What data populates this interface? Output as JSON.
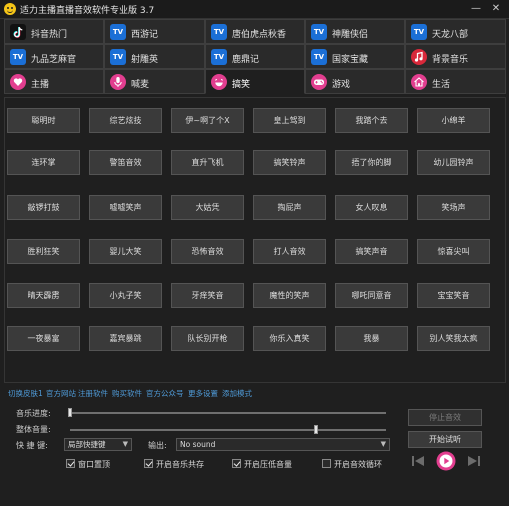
{
  "window": {
    "title": "适力主播直播音效软件专业版 3.7",
    "minimize": "—",
    "close": "✕"
  },
  "tabs": [
    {
      "label": "抖音热门",
      "icon": "tiktok-icon",
      "active": false
    },
    {
      "label": "西游记",
      "icon": "tv-icon",
      "active": false
    },
    {
      "label": "唐伯虎点秋香",
      "icon": "tv-icon",
      "active": false
    },
    {
      "label": "神雕侠侣",
      "icon": "tv-icon",
      "active": false
    },
    {
      "label": "天龙八部",
      "icon": "tv-icon",
      "active": false
    },
    {
      "label": "九品芝麻官",
      "icon": "tv-icon",
      "active": false
    },
    {
      "label": "射雕英",
      "icon": "tv-icon",
      "active": false
    },
    {
      "label": "鹿鼎记",
      "icon": "tv-icon",
      "active": false
    },
    {
      "label": "国家宝藏",
      "icon": "tv-icon",
      "active": false
    },
    {
      "label": "背景音乐",
      "icon": "music-note-icon",
      "active": false
    },
    {
      "label": "主播",
      "icon": "heart-icon",
      "active": false
    },
    {
      "label": "喊麦",
      "icon": "microphone-icon",
      "active": false
    },
    {
      "label": "搞笑",
      "icon": "laughing-face-icon",
      "active": true
    },
    {
      "label": "游戏",
      "icon": "gamepad-icon",
      "active": false
    },
    {
      "label": "生活",
      "icon": "home-icon",
      "active": false
    }
  ],
  "sound_effects": [
    [
      "聪明时",
      "综艺炫技",
      "伊~啊了个X",
      "皇上驾到",
      "我踏个去",
      "小绵羊"
    ],
    [
      "连环掌",
      "警笛音效",
      "直升飞机",
      "搞笑铃声",
      "捂了你的脚",
      "幼儿园铃声"
    ],
    [
      "敲锣打鼓",
      "嘘嘘笑声",
      "大姑凭",
      "掏屁声",
      "女人叹息",
      "笑场声"
    ],
    [
      "胜利狂笑",
      "婴儿大笑",
      "恐怖音效",
      "打人音效",
      "搞笑声音",
      "惊喜尖叫"
    ],
    [
      "晴天霹雳",
      "小丸子笑",
      "牙痒笑音",
      "魔性的笑声",
      "哪吒同意音",
      "宝宝笑音"
    ],
    [
      "一夜暴富",
      "嘉宾暴跳",
      "队长别开枪",
      "你乐入真笑",
      "我暴",
      "别人笑我太疯"
    ]
  ],
  "links": [
    "切换皮肤1",
    "官方网站",
    "注册软件",
    "购买软件",
    "官方公众号",
    "更多设置",
    "添加模式"
  ],
  "controls": {
    "music_progress_label": "音乐进度:",
    "volume_label": "整体音量:",
    "hotkey_label": "快 捷 键:",
    "hotkey_value": "局部快捷键",
    "output_label": "输出:",
    "output_value": "No sound",
    "music_progress": 0.0,
    "volume": 0.78
  },
  "checkboxes": [
    {
      "label": "窗口置顶",
      "checked": true
    },
    {
      "label": "开启音乐共存",
      "checked": true
    },
    {
      "label": "开启压低音量",
      "checked": true
    },
    {
      "label": "开启音效循环",
      "checked": false
    }
  ],
  "buttons": {
    "stop_sfx": "停止音效",
    "start_preview": "开始试听"
  },
  "colors": {
    "accent_pink": "#e23e8f",
    "tv_blue": "#1b6fd6",
    "link_blue": "#4f9bd8"
  }
}
